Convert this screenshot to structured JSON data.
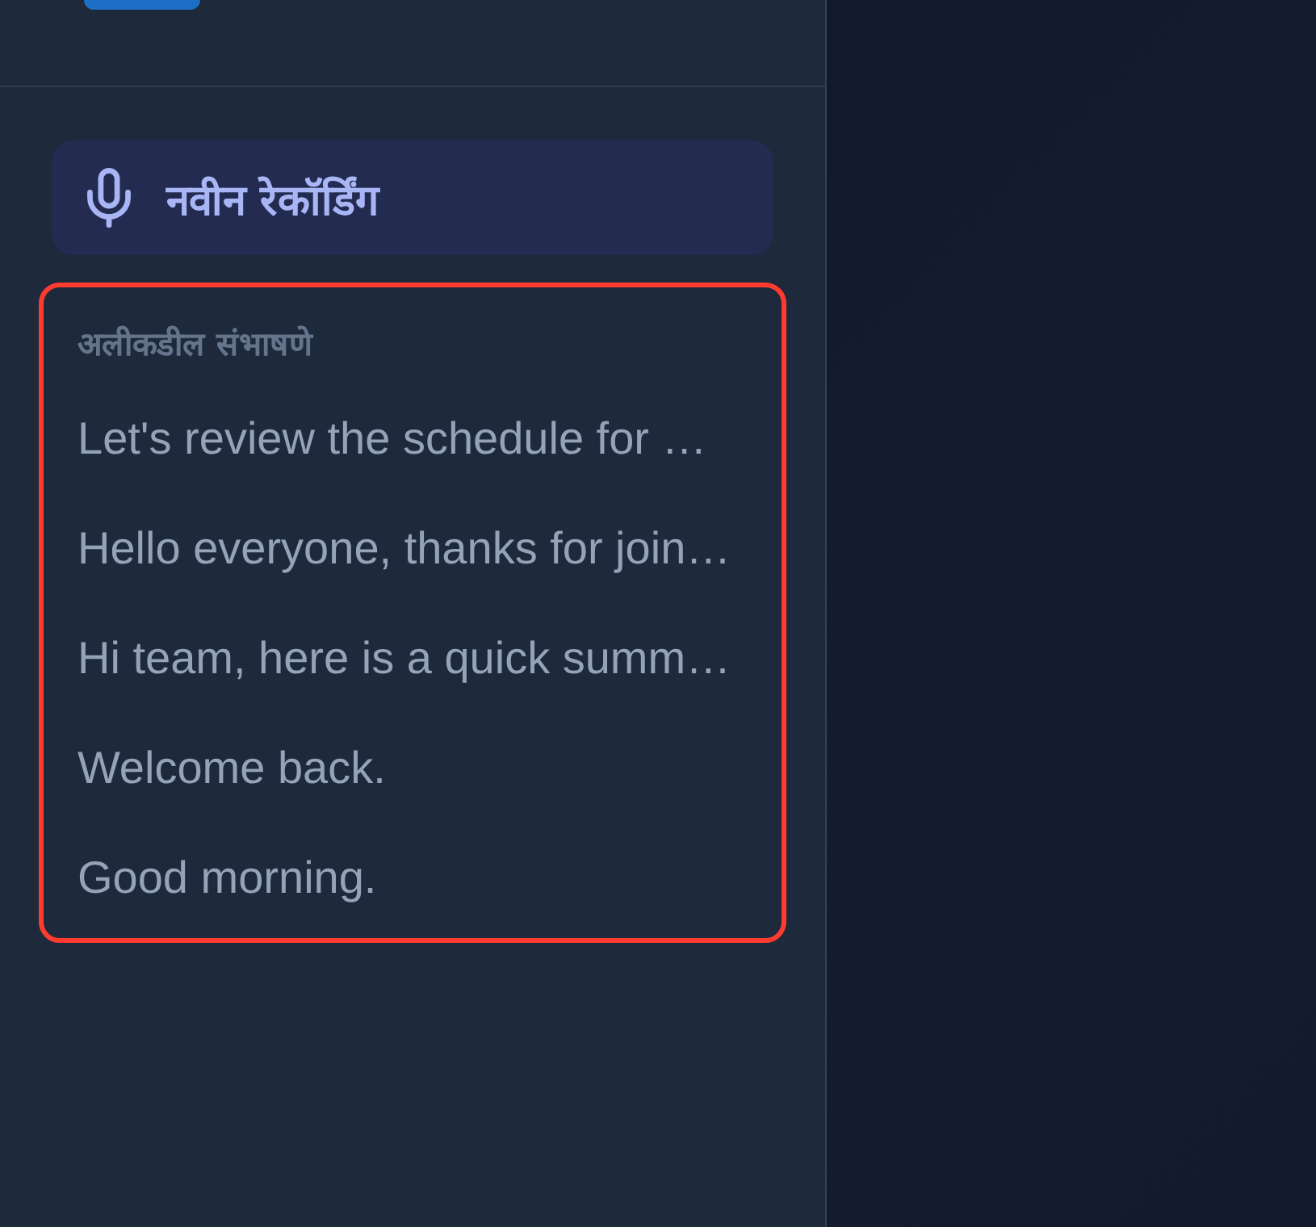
{
  "sidebar": {
    "new_recording_button": {
      "label": "नवीन रेकॉर्डिंग"
    },
    "recent_conversations": {
      "heading": "अलीकडील संभाषणे",
      "items": [
        {
          "title": "Let's review the schedule for …"
        },
        {
          "title": "Hello everyone, thanks for join…"
        },
        {
          "title": "Hi team, here is a quick summ…"
        },
        {
          "title": "Welcome back."
        },
        {
          "title": "Good morning."
        }
      ]
    }
  }
}
